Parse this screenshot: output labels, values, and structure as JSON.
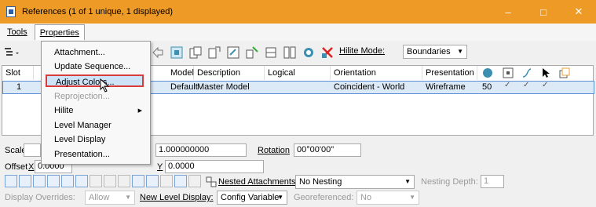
{
  "window": {
    "title": "References (1 of 1 unique, 1 displayed)",
    "minimize": "–",
    "maximize": "□",
    "close": "✕"
  },
  "menubar": {
    "tools": "Tools",
    "properties": "Properties"
  },
  "toolbar": {
    "hilite_mode_label": "Hilite Mode:",
    "hilite_mode_value": "Boundaries"
  },
  "grid": {
    "headers": [
      "Slot",
      "Model",
      "Description",
      "Logical",
      "Orientation",
      "Presentation"
    ],
    "rows": [
      {
        "slot": "1",
        "model": "Default",
        "description": "Master Model",
        "logical": "",
        "orientation": "Coincident - World",
        "presentation": "Wireframe",
        "count": "50"
      }
    ]
  },
  "properties_menu": {
    "items": [
      "Attachment...",
      "Update Sequence...",
      "Adjust Colors...",
      "Reprojection...",
      "Hilite",
      "Level Manager",
      "Level Display",
      "Presentation..."
    ]
  },
  "bottom": {
    "scale_label": "Scale",
    "scale_value": "1.000000000",
    "rotation_label": "Rotation",
    "rotation_value": "00°00'00\"",
    "offset_label": "Offset",
    "offset_x_label": "X",
    "offset_x_value": "0.0000",
    "offset_y_label": "Y",
    "offset_y_value": "0.0000",
    "nested_label": "Nested Attachments:",
    "nested_value": "No Nesting",
    "nesting_depth_label": "Nesting Depth:",
    "nesting_depth_value": "1",
    "display_overrides_label": "Display Overrides:",
    "display_overrides_value": "Allow",
    "new_level_label": "New Level Display:",
    "new_level_value": "Config Variable",
    "georef_label": "Georeferenced:",
    "georef_value": "No"
  },
  "colors": {
    "titlebar": "#ed9a27",
    "selection": "#dce9f7",
    "highlight_border": "#d93a3a"
  }
}
